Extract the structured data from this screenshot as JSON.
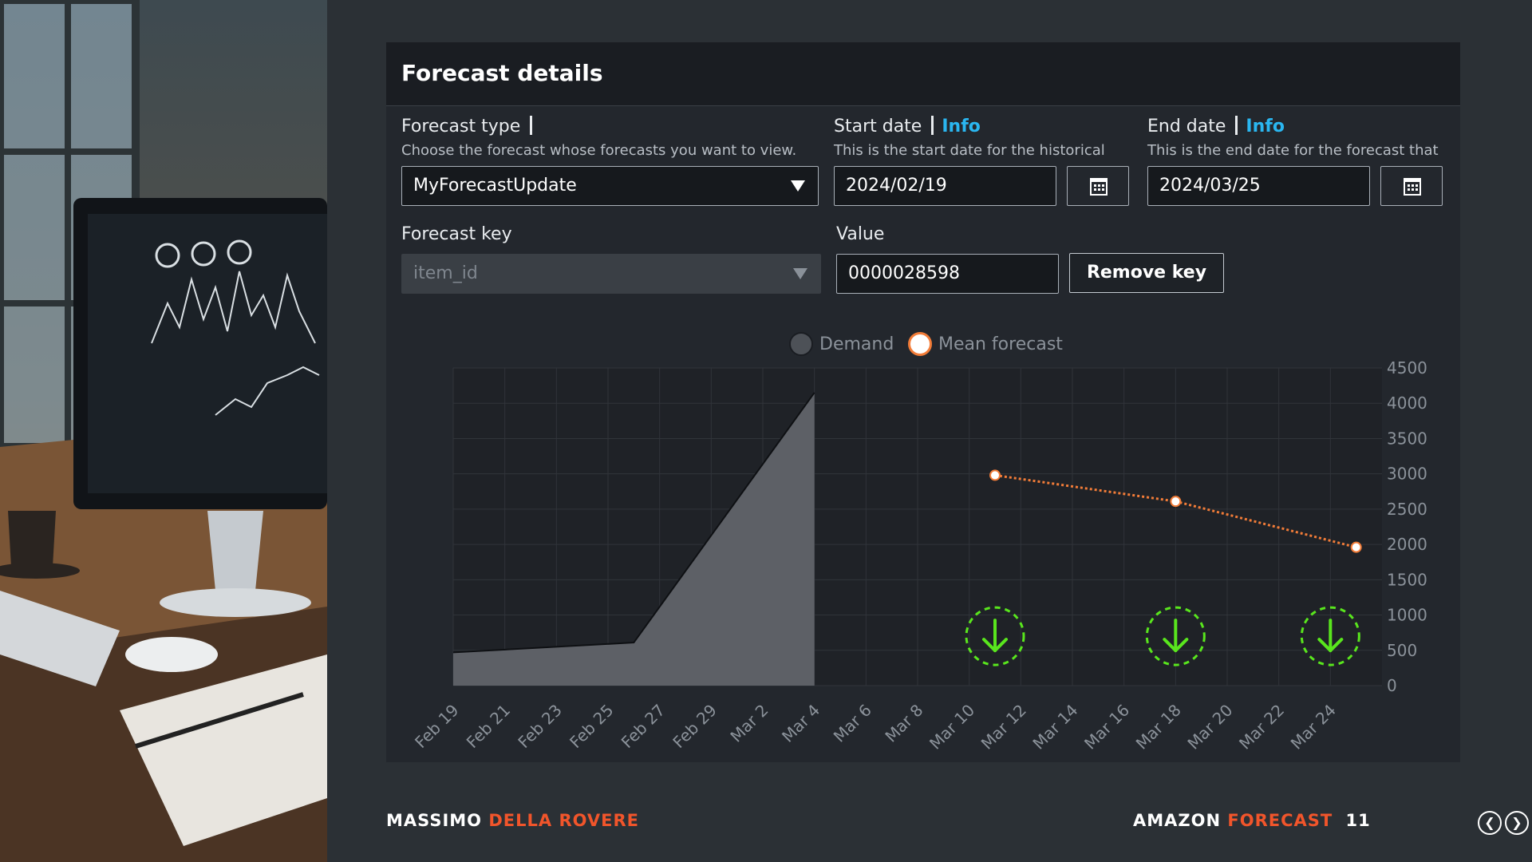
{
  "form": {
    "title": "Forecast details",
    "forecast_type": {
      "label": "Forecast type",
      "description": "Choose the forecast whose forecasts you want to view.",
      "value": "MyForecastUpdate"
    },
    "start_date": {
      "label": "Start date",
      "info": "Info",
      "description": "This is the start date for the historical",
      "value": "2024/02/19"
    },
    "end_date": {
      "label": "End date",
      "info": "Info",
      "description": "This is the end date for the forecast that",
      "value": "2024/03/25"
    },
    "forecast_key": {
      "label": "Forecast key",
      "value": "item_id"
    },
    "value": {
      "label": "Value",
      "value": "0000028598"
    },
    "remove_key_label": "Remove key"
  },
  "legend": {
    "demand": "Demand",
    "mean_forecast": "Mean forecast"
  },
  "chart_data": {
    "type": "area",
    "x_ticks": [
      "Feb 19",
      "Feb 21",
      "Feb 23",
      "Feb 25",
      "Feb 27",
      "Feb 29",
      "Mar 2",
      "Mar 4",
      "Mar 6",
      "Mar 8",
      "Mar 10",
      "Mar 12",
      "Mar 14",
      "Mar 16",
      "Mar 18",
      "Mar 20",
      "Mar 22",
      "Mar 24"
    ],
    "y_ticks": [
      "4500",
      "4000",
      "3500",
      "3000",
      "2500",
      "2000",
      "1500",
      "1000",
      "500",
      "0"
    ],
    "ylim": [
      0,
      4500
    ],
    "xlim": [
      "2024-02-19",
      "2024-03-26"
    ],
    "series": [
      {
        "name": "Demand",
        "type": "area",
        "color": "#5d6066",
        "points": [
          {
            "x": "2024-02-19",
            "y": 470
          },
          {
            "x": "2024-02-26",
            "y": 610
          },
          {
            "x": "2024-03-04",
            "y": 4150
          }
        ]
      },
      {
        "name": "Mean forecast",
        "type": "line",
        "color": "#f27c38",
        "points": [
          {
            "x": "2024-03-11",
            "y": 2980
          },
          {
            "x": "2024-03-18",
            "y": 2610
          },
          {
            "x": "2024-03-25",
            "y": 1960
          }
        ]
      }
    ],
    "annotations": [
      {
        "x": "2024-03-11",
        "y": 700,
        "icon": "down-arrow-icon",
        "color": "#59e61d"
      },
      {
        "x": "2024-03-18",
        "y": 700,
        "icon": "down-arrow-icon",
        "color": "#59e61d"
      },
      {
        "x": "2024-03-24",
        "y": 700,
        "icon": "down-arrow-icon",
        "color": "#59e61d"
      }
    ],
    "grid": true
  },
  "footer": {
    "author_first": "MASSIMO",
    "author_last": "DELLA ROVERE",
    "product_first": "AMAZON",
    "product_last": "FORECAST",
    "page_number": "11"
  },
  "colors": {
    "accent": "#f1552b",
    "info_link": "#2ab6f0",
    "background": "#2b3035",
    "panel": "#23272d"
  }
}
